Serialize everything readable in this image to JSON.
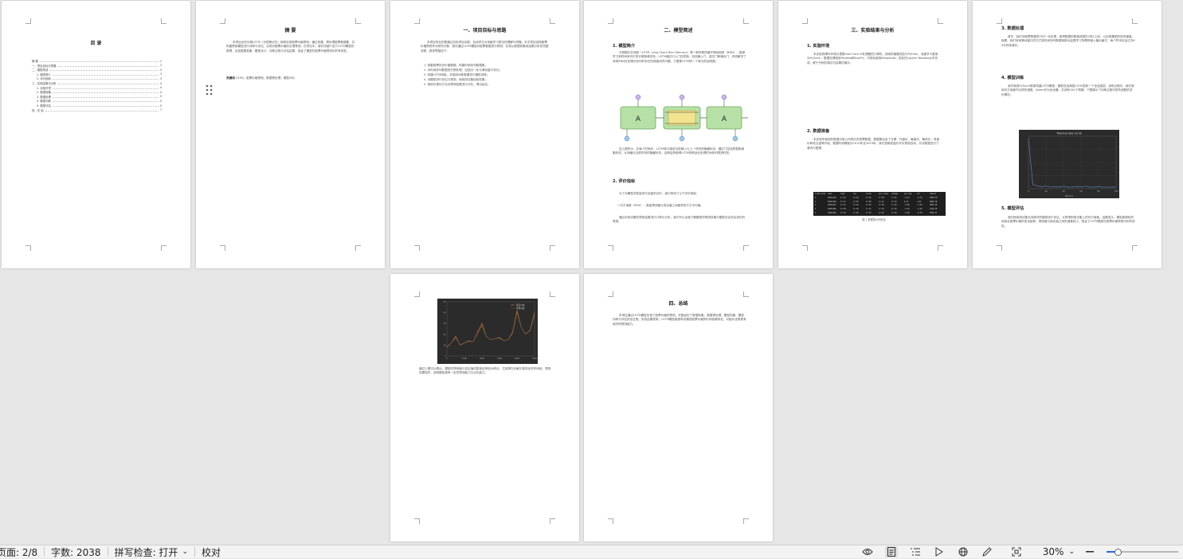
{
  "pages": {
    "toc": {
      "title": "目 录",
      "entries": [
        {
          "label": "摘 要",
          "page": "1"
        },
        {
          "label": "一、项目目标与思路",
          "page": "2"
        },
        {
          "label": "二、模型简述",
          "page": "3"
        },
        {
          "label": "1. 模型简介",
          "page": "3"
        },
        {
          "label": "2. 评价指标",
          "page": "3"
        },
        {
          "label": "三、实验结果与分析",
          "page": "4"
        },
        {
          "label": "1. 实验环境",
          "page": "4"
        },
        {
          "label": "2. 数据准备",
          "page": "4"
        },
        {
          "label": "3. 数据处理",
          "page": "5"
        },
        {
          "label": "4. 模型训练",
          "page": "5"
        },
        {
          "label": "5. 模型评估",
          "page": "5"
        },
        {
          "label": "四、总 结",
          "page": "7"
        }
      ]
    },
    "abstract": {
      "title": "摘 要",
      "body": "本项目旨在利用LSTM（长短期记忆）网络实现股票价格预测。通过收集、预处理股票数据集，并构建预测模型进行训练与评估，实现对股票价格的合理预测。在项目中，我们详细介绍了LSTM模型的原理，包括数据准备、模型设计、训练过程与评估结果，验证了模型在股票价格预测中的有效性。",
      "keywords_label": "关键词",
      "keywords": "LSTM；股票价格预测；数据预处理；模型评价"
    },
    "goal": {
      "title": "一、项目目标与思路",
      "intro": "本项目的目的是通过实际项目实践，加深学生对深度学习算法的理解与掌握。本次项目选择股票价格预测作为研究对象，首先通过LSTM模型对股票数据进行预测，实现从数据收集到结果分析的完整流程，具体思路如下：",
      "steps": [
        "1. 收集股票历史价格数据，构建时间序列数据集；",
        "2. 对时间序列数据进行预处理，包括归一化与滑动窗口划分；",
        "3. 构建LSTM网络，并使用训练数据进行模型训练；",
        "4. 对模型进行评估与预测，使用测试集检验效果；",
        "5. 使用可视化方法对预测结果进行分析，得出结论。"
      ]
    },
    "model": {
      "title": "二、模型简述",
      "sec1": "1. 模型简介",
      "sec1_body": "长短期记忆网络（LSTM, Long Short-Term Memory）是一种特殊的循环神经网络（RNN），能够学习到时间序列中的长期依赖关系。LSTM通过引入门控机制，包括输入门、遗忘门和输出门，有效解决了传统RNN在处理长序列时存在的梯度消失问题。下图是LSTM的一个单元的结构图。",
      "cell_label": "A",
      "diagram_caption_body": "如上图所示，在每个时间步，LSTM单元接收当前输入与上一时刻的隐藏状态，通过门控结构更新细胞状态，从而输出当前时刻的隐藏状态。这种结构使得LSTM特别适合处理时间序列预测任务。",
      "sec2": "2. 评价指标",
      "sec2_intro": "为了对模型的性能进行全面的评价，我们采用了以下评价指标：",
      "sec2_item": "均方误差（MSE）：衡量预测值与真实值之间差异的平方平均值。",
      "sec2_end": "通过对测试集的预测结果进行计算与分析，我们可以全面了解模型的预测效果与模型在实际应用中的表现。"
    },
    "results": {
      "title": "三、实验结果与分析",
      "sec1": "1. 实验环境",
      "sec1_body": "本实验的硬件环境为搭载Intel Core i5处理器的计算机，使用的编程语言为Python，深度学习框架为PyTorch，数据处理使用Pandas和NumPy，可视化使用Matplotlib。实验在Jupyter Notebook中完成，便于代码的调试与结果的展示。",
      "sec2": "2. 数据准备",
      "sec2_body": "本实验所使用的数据为某公司的历史股票数据，数据集包含了日期、开盘价、最高价、最低价、收盘价和成交量等字段。数据时间跨度为2015年至2023年。我们选取收盘价作为预测目标，并对数据进行了清洗与整理。",
      "table_headers": [
        "trade_date",
        "open",
        "high",
        "low",
        "close",
        "pre_close",
        "change",
        "pct_chg",
        "vol",
        "amount"
      ],
      "table_rows": [
        [
          "0",
          "20231229",
          "17.42",
          "17.52",
          "17.25",
          "17.28",
          "17.41",
          "-0.13",
          "-0.75",
          "4500.32"
        ],
        [
          "1",
          "20231228",
          "17.11",
          "17.50",
          "17.06",
          "17.41",
          "17.10",
          "0.31",
          "1.81",
          "6020.18"
        ],
        [
          "2",
          "20231227",
          "17.15",
          "17.24",
          "17.02",
          "17.10",
          "17.16",
          "-0.06",
          "-0.35",
          "3801.66"
        ],
        [
          "3",
          "20231226",
          "17.30",
          "17.36",
          "17.11",
          "17.16",
          "17.32",
          "-0.16",
          "-0.92",
          "4122.49"
        ],
        [
          "4",
          "20231225",
          "17.40",
          "17.45",
          "17.21",
          "17.32",
          "17.38",
          "-0.06",
          "-0.35",
          "3650.27"
        ]
      ],
      "table_caption": "图 1 数据集示例信息"
    },
    "train": {
      "sec3": "3. 数据处理",
      "sec3_body": "首先，我们对股票数据进行归一化处理，使得数据的数值范围在0到1之间，以加快模型的收敛速度。接着，我们采用滑动窗口的方式将时间序列数据转换为监督学习所需的输入输出格式，每个样本包含过去60天的收盘价。",
      "sec4": "4. 模型训练",
      "sec4_body": "我们使用PyTorch框架构建LSTM模型，模型包含两层LSTM层和一个全连接层。训练过程中，我们使用均方误差作为损失函数，Adam作为优化器，共训练100个周期。下图展示了训练过程中损失函数的变化情况。",
      "chart_title": "Training loss curve",
      "chart_xlabel": "Epoch",
      "sec5": "5. 模型评估",
      "sec5_body": "我们使用测试集对训练好的模型进行评估，计算得到测试集上的均方误差。结果显示，模型能够较好地拟合股票价格的变化趋势，预测值与真实值之间的误差较小，验证了LSTM模型在股票价格预测中的有效性。"
    },
    "pred": {
      "legend": [
        "真实价格",
        "预测价格"
      ],
      "body": "通过上图可以看出，模型的预测值与真实值的整体走势较为吻合，尤其是在价格平稳变化的时间段，预测效果较好，说明模型具有一定的预测能力与泛化能力。"
    },
    "summary": {
      "title": "四、总结",
      "body": "本项目通过LSTM模型实现了股票价格的预测，完整经历了数据收集、数据预处理、模型构建、模型训练与评估的全过程。实验结果表明，LSTM模型能够有效捕捉股票价格的时间依赖特征，对股价走势具有较好的预测能力。"
    }
  },
  "chart_data": [
    {
      "type": "line",
      "title": "Training loss curve",
      "xlabel": "Epoch",
      "ylabel": "",
      "x": [
        0,
        5,
        10,
        15,
        20,
        25,
        30,
        35,
        40,
        45,
        50,
        55,
        60,
        65,
        70,
        75,
        80,
        85,
        90,
        95,
        100
      ],
      "series": [
        {
          "name": "",
          "values": [
            0.95,
            0.08,
            0.05,
            0.04,
            0.05,
            0.03,
            0.04,
            0.03,
            0.05,
            0.03,
            0.03,
            0.04,
            0.03,
            0.05,
            0.03,
            0.03,
            0.04,
            0.03,
            0.03,
            0.03,
            0.03
          ]
        }
      ],
      "ylim": [
        0,
        1.0
      ],
      "grid": true,
      "background": "#2b2b2b",
      "line_color": "#5b7fb5"
    },
    {
      "type": "line",
      "title": "",
      "x": [
        0,
        250,
        500,
        750,
        1000,
        1250,
        1500,
        1750,
        2000,
        2250,
        2500,
        2750,
        3000,
        3250,
        3500,
        3750,
        4000,
        4250,
        4500,
        4750,
        5000
      ],
      "series": [
        {
          "name": "真实价格",
          "values": [
            8,
            12,
            18,
            10,
            12,
            14,
            13,
            22,
            30,
            18,
            15,
            16,
            17,
            14,
            15,
            22,
            42,
            26,
            20,
            24,
            40
          ]
        },
        {
          "name": "预测价格",
          "values": [
            8.5,
            12,
            17,
            10.5,
            12,
            13.5,
            13,
            21,
            28,
            18,
            15,
            16,
            16.5,
            14,
            15,
            21,
            40,
            26,
            20,
            23.5,
            38
          ]
        }
      ],
      "ylim": [
        0,
        50
      ],
      "background": "#2b2b2b",
      "colors": [
        "#c9803a",
        "#7a5a3a"
      ]
    }
  ],
  "statusbar": {
    "page_info": "页面: 2/8",
    "word_count": "字数: 2038",
    "spellcheck": "拼写检查: 打开",
    "proofread": "校对",
    "zoom": "30%",
    "zoom_value": 30,
    "zoom_fraction": 0.16
  }
}
